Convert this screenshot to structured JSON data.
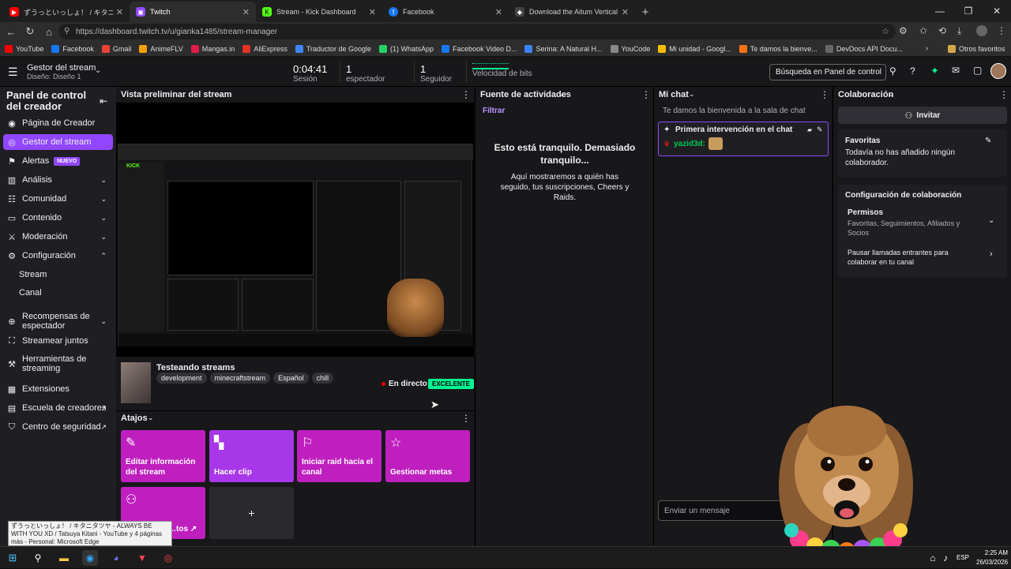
{
  "browser": {
    "tabs": [
      {
        "title": "ずうっといっしょ！ / キタニタツヤ -",
        "fav_color": "#ff0000",
        "fav": "▶"
      },
      {
        "title": "Twitch",
        "fav_color": "#9147ff",
        "fav": "▣"
      },
      {
        "title": "Stream - Kick Dashboard",
        "fav_color": "#53fc18",
        "fav": "K"
      },
      {
        "title": "Facebook",
        "fav_color": "#1877f2",
        "fav": "f"
      },
      {
        "title": "Download the Aitum Vertical Plug",
        "fav_color": "#444",
        "fav": "◆"
      }
    ],
    "url": "https://dashboard.twitch.tv/u/gianka1485/stream-manager",
    "bookmarks": [
      {
        "label": "YouTube",
        "color": "#ff0000"
      },
      {
        "label": "Facebook",
        "color": "#1877f2"
      },
      {
        "label": "Gmail",
        "color": "#ea4335"
      },
      {
        "label": "AnimeFLV",
        "color": "#f59e0b"
      },
      {
        "label": "Mangas.in",
        "color": "#e11d48"
      },
      {
        "label": "AliExpress",
        "color": "#e43225"
      },
      {
        "label": "Traductor de Google",
        "color": "#4285f4"
      },
      {
        "label": "(1) WhatsApp",
        "color": "#25d366"
      },
      {
        "label": "Facebook Video D...",
        "color": "#1877f2"
      },
      {
        "label": "Serina: A Natural H...",
        "color": "#3b82f6"
      },
      {
        "label": "YouCode",
        "color": "#888"
      },
      {
        "label": "Mi unidad - Googl...",
        "color": "#fbbc04"
      },
      {
        "label": "Te damos la bienve...",
        "color": "#f97316"
      },
      {
        "label": "DevDocs API Docu...",
        "color": "#666"
      }
    ],
    "other_bookmarks": "Otros favoritos"
  },
  "topbar": {
    "title": "Gestor del stream",
    "subtitle": "Diseño: Diseño 1",
    "session_value": "0:04:41",
    "session_label": "Sesión",
    "viewers_value": "1",
    "viewers_label": "espectador",
    "followers_value": "1",
    "followers_label": "Seguidor",
    "bitrate_label": "Velocidad de bits",
    "search_placeholder": "Búsqueda en Panel de control"
  },
  "sidebar": {
    "title": "Panel de control del creador",
    "items": [
      {
        "label": "Página de Creador",
        "icon": "◉",
        "chev": ""
      },
      {
        "label": "Gestor del stream",
        "icon": "◎",
        "chev": ""
      },
      {
        "label": "Alertas",
        "icon": "⚑",
        "chev": ""
      },
      {
        "label": "Análisis",
        "icon": "▥",
        "chev": "⌄"
      },
      {
        "label": "Comunidad",
        "icon": "☷",
        "chev": "⌄"
      },
      {
        "label": "Contenido",
        "icon": "▭",
        "chev": "⌄"
      },
      {
        "label": "Moderación",
        "icon": "⚔",
        "chev": "⌄"
      },
      {
        "label": "Configuración",
        "icon": "⚙",
        "chev": "⌃"
      },
      {
        "label": "Stream",
        "icon": "",
        "chev": ""
      },
      {
        "label": "Canal",
        "icon": "",
        "chev": ""
      },
      {
        "label": "Recompensas de espectador",
        "icon": "⊕",
        "chev": "⌄"
      },
      {
        "label": "Streamear juntos",
        "icon": "⛶",
        "chev": ""
      },
      {
        "label": "Herramientas de streaming",
        "icon": "⚒",
        "chev": ""
      },
      {
        "label": "Extensiones",
        "icon": "▦",
        "chev": ""
      },
      {
        "label": "Escuela de creadores",
        "icon": "▤",
        "chev": "↗"
      },
      {
        "label": "Centro de seguridad",
        "icon": "⛉",
        "chev": "↗"
      }
    ],
    "new_badge": "NUEVO"
  },
  "preview": {
    "header": "Vista preliminar del stream",
    "stream_title": "Testeando streams",
    "tags": [
      "development",
      "minecraftstream",
      "Español",
      "chill"
    ],
    "live_label": "En directo",
    "quality_badge": "EXCELENTE"
  },
  "shortcuts": {
    "header": "Atajos",
    "items": [
      {
        "label": "Editar información del stream",
        "icon": "✎"
      },
      {
        "label": "Hacer clip",
        "icon": "🎬"
      },
      {
        "label": "Iniciar raid hacia el canal",
        "icon": "⚐"
      },
      {
        "label": "Gestionar metas",
        "icon": "☆"
      },
      {
        "label": "…tos ↗",
        "icon": "⚇"
      }
    ],
    "add_label": "+"
  },
  "activity": {
    "header": "Fuente de actividades",
    "filter": "Filtrar",
    "empty_title": "Esto está tranquilo. Demasiado tranquilo...",
    "empty_body": "Aquí mostraremos a quién has seguido, tus suscripciones, Cheers y Raids."
  },
  "chat": {
    "header": "Mi chat",
    "welcome": "Te damos la bienvenida a la sala de chat",
    "first_label": "Primera intervención en el chat",
    "user": "yazid3d:",
    "input_placeholder": "Enviar un mensaje"
  },
  "collab": {
    "header": "Colaboración",
    "invite": "Invitar",
    "fav_title": "Favoritas",
    "fav_body": "Todavía no has añadido ningún colaborador.",
    "config_title": "Configuración de colaboración",
    "perm_title": "Permisos",
    "perm_body": "Favoritas, Seguimientos, Afiliados y Socios",
    "pause_body": "Pausar llamadas entrantes para colaborar en tu canal"
  },
  "tooltip": {
    "text": "ずうっといっしょ！ / キタニタツヤ - ALWAYS BE WITH YOU XD / Tatsuya Kitani - YouTube y 4 páginas más - Personal: Microsoft Edge"
  },
  "taskbar": {
    "lang": "ESP",
    "time": "2:25 AM",
    "date": "26/03/2026"
  },
  "colors": {
    "accent": "#9147ff",
    "shortcut": "#bf1fbf",
    "live_green": "#00f593"
  }
}
